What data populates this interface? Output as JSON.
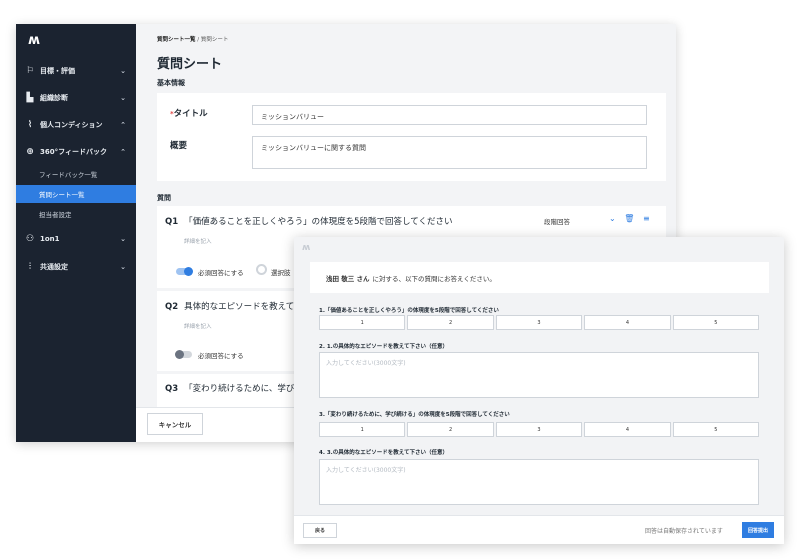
{
  "sidebar": {
    "logo": "ʍ",
    "items": [
      {
        "icon": "⚐",
        "label": "目標・評価",
        "chevron": "⌄"
      },
      {
        "icon": "▙",
        "label": "組織診断",
        "chevron": "⌄"
      },
      {
        "icon": "⌇",
        "label": "個人コンディション",
        "chevron": "⌃"
      },
      {
        "icon": "⊕",
        "label": "360°フィードバック",
        "chevron": "⌃"
      },
      {
        "icon": "⚇",
        "label": "1on1",
        "chevron": "⌄"
      },
      {
        "icon": "⫶",
        "label": "共通設定",
        "chevron": "⌄"
      }
    ],
    "sub_items": [
      {
        "label": "フィードバック一覧"
      },
      {
        "label": "質問シート一覧"
      },
      {
        "label": "担当者設定"
      }
    ]
  },
  "breadcrumb": {
    "parent": "質問シート一覧",
    "separator": " / ",
    "current": "質問シート"
  },
  "page_title": "質問シート",
  "basic_info": {
    "section_label": "基本情報",
    "title_label": "タイトル",
    "required_mark": "*",
    "title_value": "ミッションバリュー",
    "summary_label": "概要",
    "summary_value": "ミッションバリューに関する質問"
  },
  "questions": {
    "section_label": "質問",
    "items": [
      {
        "num": "Q1",
        "text": "「価値あることを正しくやろう」の体現度を5段階で回答してください",
        "placeholder": "詳細を記入",
        "type": "段階回答",
        "required_label": "必須回答にする",
        "option_label": "選択肢"
      },
      {
        "num": "Q2",
        "text": "具体的なエピソードを教えて",
        "placeholder": "詳細を記入",
        "required_label": "必須回答にする"
      },
      {
        "num": "Q3",
        "text": "「変わり続けるために、学び"
      }
    ]
  },
  "footer": {
    "cancel_label": "キャンセル"
  },
  "preview": {
    "logo": "ʍ",
    "greeting_name": "浅田 敬三 さん",
    "greeting_text": "に対する、以下の質問にお答えください。",
    "questions": [
      {
        "label": "1.「価値あることを正しくやろう」の体現度を5段階で回答してください",
        "kind": "scale",
        "options": [
          "1",
          "2",
          "3",
          "4",
          "5"
        ]
      },
      {
        "label": "2. 1.の具体的なエピソードを教えて下さい（任意）",
        "kind": "text",
        "placeholder": "入力してください(3000文字)"
      },
      {
        "label": "3.「変わり続けるために、学び続ける」の体現度を5段階で回答してください",
        "kind": "scale",
        "options": [
          "1",
          "2",
          "3",
          "4",
          "5"
        ]
      },
      {
        "label": "4. 3.の具体的なエピソードを教えて下さい（任意）",
        "kind": "text",
        "placeholder": "入力してください(3000文字)"
      }
    ],
    "back_label": "戻る",
    "autosave_text": "回答は自動保存されています",
    "submit_label": "回答提出"
  },
  "colors": {
    "accent": "#2f7de1",
    "sidebar_bg": "#1b2330",
    "required": "#e24a4a"
  }
}
